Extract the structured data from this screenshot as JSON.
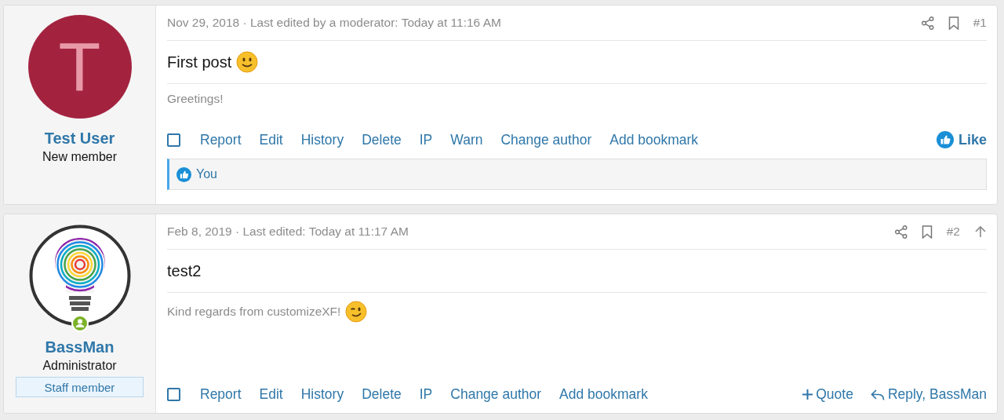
{
  "posts": [
    {
      "author": {
        "name": "Test User",
        "title": "New member",
        "avatar": {
          "kind": "letter",
          "letter": "T",
          "color": "#a3233f"
        }
      },
      "meta": "Nov 29, 2018 · Last edited by a moderator: Today at 11:16 AM",
      "number": "#1",
      "content": "First post",
      "content_emoji": {
        "kind": "smile"
      },
      "signature": "Greetings!",
      "checked": false,
      "actions": [
        "Report",
        "Edit",
        "History",
        "Delete",
        "IP",
        "Warn",
        "Change author",
        "Add bookmark"
      ],
      "right_actions": [
        {
          "kind": "like",
          "label": "Like"
        }
      ],
      "reactions": {
        "label": "You"
      }
    },
    {
      "author": {
        "name": "BassMan",
        "title": "Administrator",
        "online": true,
        "badge": "Staff member"
      },
      "meta": "Feb 8, 2019 · Last edited: Today at 11:17 AM",
      "number": "#2",
      "jump_up": true,
      "content": "test2",
      "signature": "Kind regards from customizeXF!",
      "signature_emoji": {
        "kind": "wink"
      },
      "checked": false,
      "actions": [
        "Report",
        "Edit",
        "History",
        "Delete",
        "IP",
        "Change author",
        "Add bookmark"
      ],
      "right_actions": [
        {
          "kind": "quote",
          "label": "Quote"
        },
        {
          "kind": "reply",
          "label": "Reply, BassMan"
        }
      ]
    }
  ]
}
